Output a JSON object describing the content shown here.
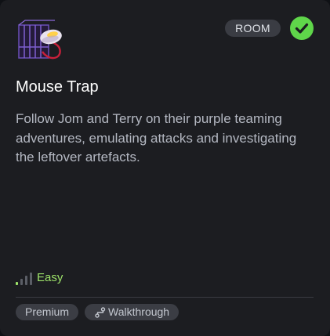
{
  "card": {
    "room_image": "mouse-trap-room-icon",
    "type_badge": "ROOM",
    "completed_icon": "check-circle-icon",
    "title": "Mouse Trap",
    "description": "Follow Jom and Terry on their purple teaming adventures, emulating attacks and investigating the leftover artefacts.",
    "difficulty": {
      "icon": "signal-bars-icon",
      "label": "Easy",
      "color": "#9ee46a"
    },
    "tags": [
      {
        "label": "Premium"
      },
      {
        "label": "Walkthrough",
        "icon": "walkthrough-path-icon"
      }
    ]
  },
  "colors": {
    "card_background": "#1c1d21",
    "accent_green": "#5fd64a",
    "description_text": "#b4b8c2"
  }
}
